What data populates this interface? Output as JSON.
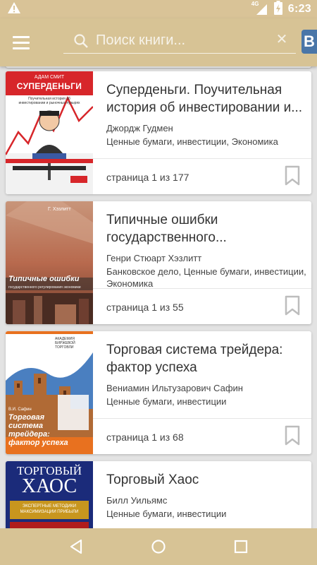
{
  "status_bar": {
    "time": "6:23",
    "network": "4G",
    "battery_level": "charging",
    "icons": [
      "warning-icon",
      "signal-icon",
      "battery-icon"
    ]
  },
  "app_bar": {
    "menu_icon": "hamburger-menu-icon",
    "search": {
      "placeholder": "Поиск книги...",
      "value": ""
    },
    "social_badge": "В"
  },
  "books": [
    {
      "title": "Суперденьги. Поучительная история об инвестировании и...",
      "author": "Джордж Гудмен",
      "categories": "Ценные бумаги, инвестиции, Экономика",
      "page_info": "страница 1 из 177",
      "cover": {
        "author_line": "АДАМ СМИТ",
        "title_line": "СУПЕРДЕНЬГИ",
        "subtitle_line": "Поучительная история об инвестировании и рыночных пузырях"
      }
    },
    {
      "title": "Типичные ошибки государственного...",
      "author": "Генри Стюарт Хэзлитт",
      "categories": "Банковское дело, Ценные бумаги, инвестиции, Экономика",
      "page_info": "страница 1 из 55",
      "cover": {
        "author_line": "Г. Хэзлитт",
        "title_line": "Типичные ошибки",
        "subtitle_line": "государственного регулирования экономики"
      }
    },
    {
      "title": "Торговая система трейдера: фактор успеха",
      "author": "Вениамин Ильтузарович Сафин",
      "categories": "Ценные бумаги, инвестиции",
      "page_info": "страница 1 из 68",
      "cover": {
        "author_line": "В.И. Сафин",
        "title_line": "Торговая система трейдера: фактор успеха",
        "series_line": "АКАДЕМИЯ БИРЖЕВОЙ ТОРГОВЛИ"
      }
    },
    {
      "title": "Торговый Хаос",
      "author": "Билл Уильямс",
      "categories": "Ценные бумаги, инвестиции",
      "page_info": "",
      "cover": {
        "title_line_1": "ТОРГОВЫЙ",
        "title_line_2": "ХАОС",
        "subtitle_line": "ЭКСПЕРТНЫЕ МЕТОДИКИ МАКСИМИЗАЦИИ ПРИБЫЛИ"
      }
    }
  ],
  "nav_bar": {
    "back": "back-icon",
    "home": "home-icon",
    "recents": "recents-icon"
  },
  "colors": {
    "accent": "#d7c395",
    "card": "#ffffff",
    "background": "#e3e3e3",
    "bookmark": "#bdbdbd"
  }
}
